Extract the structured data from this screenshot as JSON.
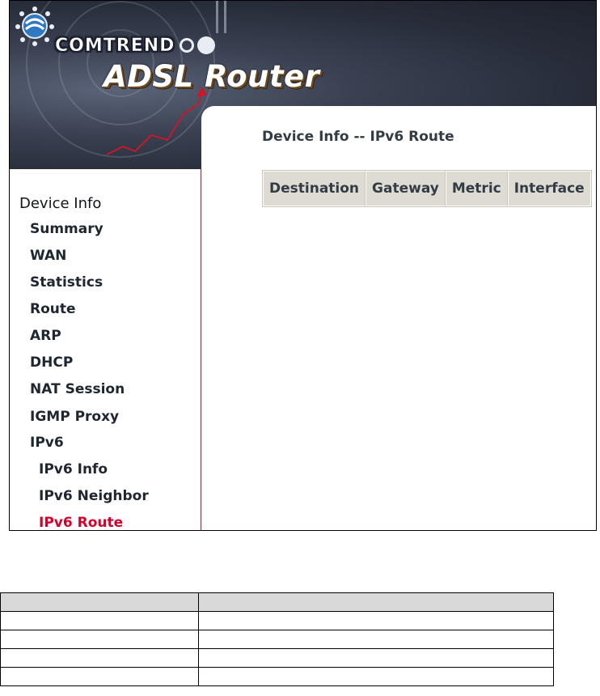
{
  "brand": {
    "company": "COMTREND",
    "product": "ADSL Router"
  },
  "page": {
    "title": "Device Info -- IPv6 Route"
  },
  "colors": {
    "active_nav": "#d4002a",
    "table_header_bg": "#dedbd3",
    "sidebar_border": "#a0223a"
  },
  "sidebar": {
    "items": [
      {
        "label": "Device Info",
        "level": 0,
        "active": false
      },
      {
        "label": "Summary",
        "level": 1,
        "active": false
      },
      {
        "label": "WAN",
        "level": 1,
        "active": false
      },
      {
        "label": "Statistics",
        "level": 1,
        "active": false
      },
      {
        "label": "Route",
        "level": 1,
        "active": false
      },
      {
        "label": "ARP",
        "level": 1,
        "active": false
      },
      {
        "label": "DHCP",
        "level": 1,
        "active": false
      },
      {
        "label": "NAT Session",
        "level": 1,
        "active": false
      },
      {
        "label": "IGMP Proxy",
        "level": 1,
        "active": false
      },
      {
        "label": "IPv6",
        "level": 1,
        "active": false
      },
      {
        "label": "IPv6 Info",
        "level": 2,
        "active": false
      },
      {
        "label": "IPv6 Neighbor",
        "level": 2,
        "active": false
      },
      {
        "label": "IPv6 Route",
        "level": 2,
        "active": true
      }
    ]
  },
  "route_table": {
    "columns": [
      "Destination",
      "Gateway",
      "Metric",
      "Interface"
    ],
    "rows": []
  },
  "doc_table": {
    "rows": [
      [
        "",
        ""
      ],
      [
        "",
        ""
      ],
      [
        "",
        ""
      ],
      [
        "",
        ""
      ],
      [
        "",
        ""
      ]
    ]
  }
}
